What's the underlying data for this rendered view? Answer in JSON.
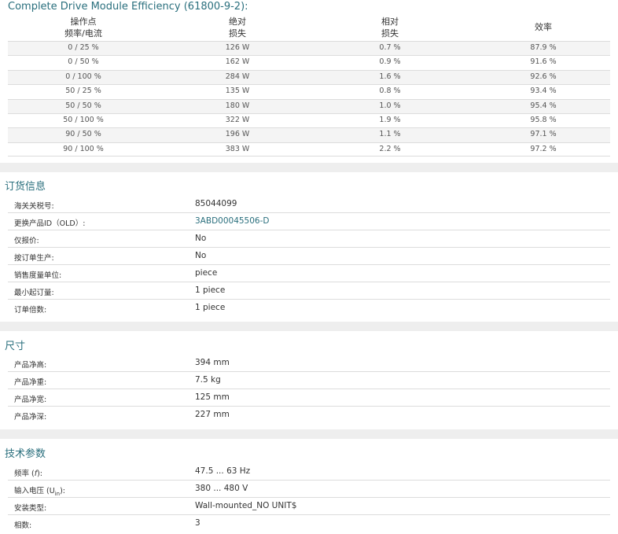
{
  "efficiency": {
    "title": "Complete Drive Module Efficiency (61800-9-2):",
    "headers": [
      {
        "line1": "操作点",
        "line2": "频率/电流"
      },
      {
        "line1": "绝对",
        "line2": "损失"
      },
      {
        "line1": "相对",
        "line2": "损失"
      },
      {
        "line1": "效率",
        "line2": ""
      }
    ],
    "rows": [
      [
        "0 / 25 %",
        "126 W",
        "0.7 %",
        "87.9 %"
      ],
      [
        "0 / 50 %",
        "162 W",
        "0.9 %",
        "91.6 %"
      ],
      [
        "0 / 100 %",
        "284 W",
        "1.6 %",
        "92.6 %"
      ],
      [
        "50 / 25 %",
        "135 W",
        "0.8 %",
        "93.4 %"
      ],
      [
        "50 / 50 %",
        "180 W",
        "1.0 %",
        "95.4 %"
      ],
      [
        "50 / 100 %",
        "322 W",
        "1.9 %",
        "95.8 %"
      ],
      [
        "90 / 50 %",
        "196 W",
        "1.1 %",
        "97.1 %"
      ],
      [
        "90 / 100 %",
        "383 W",
        "2.2 %",
        "97.2 %"
      ]
    ]
  },
  "ordering": {
    "title": "订货信息",
    "rows": [
      {
        "label": "海关关税号:",
        "value": "85044099",
        "link": false
      },
      {
        "label": "更换产品ID（OLD）:",
        "value": "3ABD00045506-D",
        "link": true
      },
      {
        "label": "仅报价:",
        "value": "No",
        "link": false
      },
      {
        "label": "按订单生产:",
        "value": "No",
        "link": false
      },
      {
        "label": "销售度量单位:",
        "value": "piece",
        "link": false
      },
      {
        "label": "最小起订量:",
        "value": "1 piece",
        "link": false
      },
      {
        "label": "订单倍数:",
        "value": "1 piece",
        "link": false
      }
    ]
  },
  "dimensions": {
    "title": "尺寸",
    "rows": [
      {
        "label": "产品净高:",
        "value": "394 mm"
      },
      {
        "label": "产品净重:",
        "value": "7.5 kg"
      },
      {
        "label": "产品净宽:",
        "value": "125 mm"
      },
      {
        "label": "产品净深:",
        "value": "227 mm"
      }
    ]
  },
  "technical": {
    "title": "技术参数",
    "rows": [
      {
        "label_prefix": "频率 (",
        "label_symbol": "f",
        "label_sub": "",
        "label_suffix": "):",
        "value": "47.5 ... 63 Hz"
      },
      {
        "label_prefix": "输入电压 (U",
        "label_symbol": "",
        "label_sub": "in",
        "label_suffix": "):",
        "value": "380 ... 480 V"
      },
      {
        "label_prefix": "安装类型:",
        "label_symbol": "",
        "label_sub": "",
        "label_suffix": "",
        "value": "Wall-mounted_NO UNIT$"
      },
      {
        "label_prefix": "相数:",
        "label_symbol": "",
        "label_sub": "",
        "label_suffix": "",
        "value": "3"
      }
    ]
  }
}
